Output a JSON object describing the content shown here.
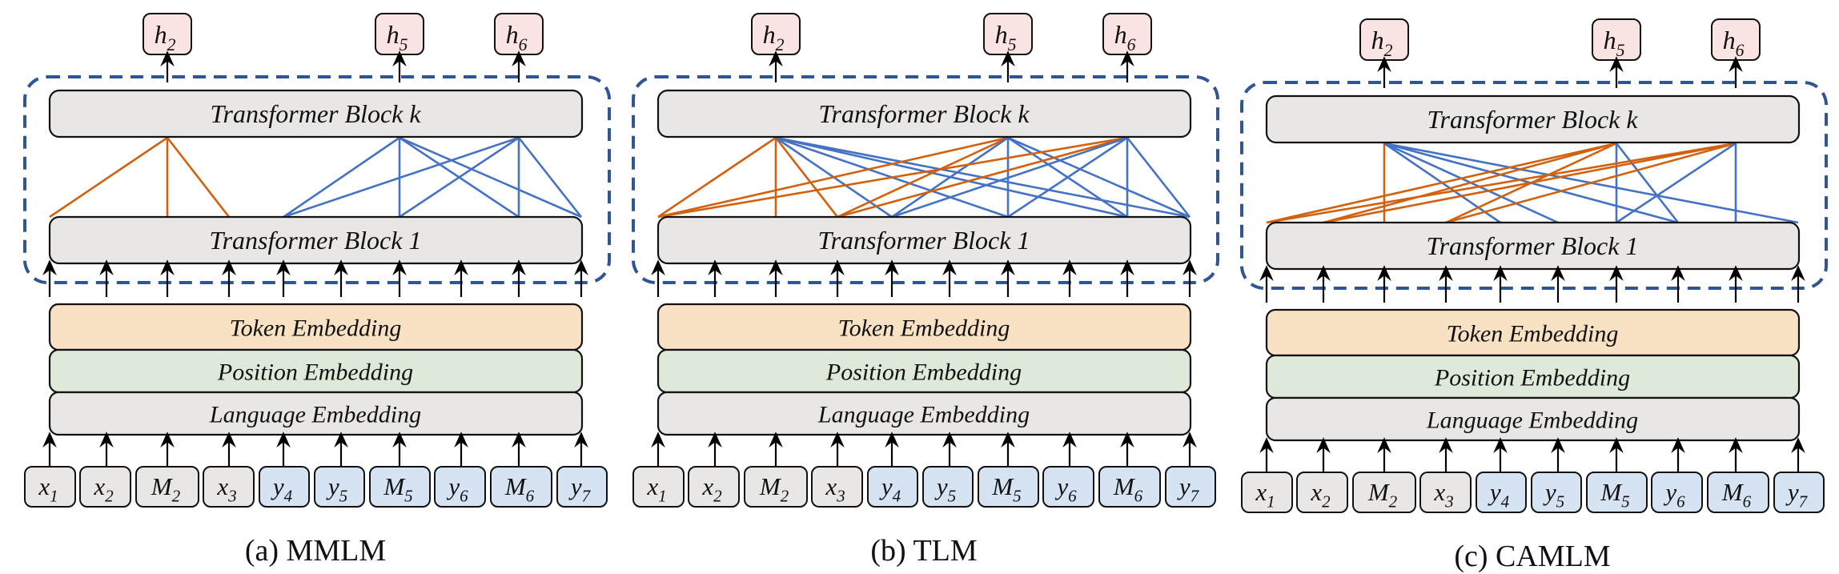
{
  "colors": {
    "block_fill": "#e8e7e5",
    "token_embedding_fill": "#f8e2c3",
    "position_embedding_fill": "#dfe9d9",
    "language_embedding_fill": "#e8e7e5",
    "source_token_fill": "#e8e7e5",
    "target_token_fill": "#d5e3f3",
    "output_fill": "#fae3e3",
    "dashed_box": "#2f5597",
    "source_edge": "#d3600d",
    "target_edge": "#4472c4"
  },
  "labels": {
    "block_k": "Transformer Block k",
    "block_1": "Transformer Block 1",
    "token_embedding": "Token Embedding",
    "position_embedding": "Position Embedding",
    "language_embedding": "Language Embedding"
  },
  "tokens": [
    {
      "base": "x",
      "sub": "1",
      "lang": "source"
    },
    {
      "base": "x",
      "sub": "2",
      "lang": "source"
    },
    {
      "base": "M",
      "sub": "2",
      "lang": "source"
    },
    {
      "base": "x",
      "sub": "3",
      "lang": "source"
    },
    {
      "base": "y",
      "sub": "4",
      "lang": "target"
    },
    {
      "base": "y",
      "sub": "5",
      "lang": "target"
    },
    {
      "base": "M",
      "sub": "5",
      "lang": "target"
    },
    {
      "base": "y",
      "sub": "6",
      "lang": "target"
    },
    {
      "base": "M",
      "sub": "6",
      "lang": "target"
    },
    {
      "base": "y",
      "sub": "7",
      "lang": "target"
    }
  ],
  "outputs": [
    {
      "base": "h",
      "sub": "2",
      "column": 2
    },
    {
      "base": "h",
      "sub": "5",
      "column": 6
    },
    {
      "base": "h",
      "sub": "6",
      "column": 8
    }
  ],
  "panels": [
    {
      "caption": "(a)  MMLM",
      "edges": [
        {
          "from": 2,
          "to": [
            0,
            2,
            3
          ],
          "color": "source"
        },
        {
          "from": 6,
          "to": [
            4,
            6,
            8,
            9
          ],
          "color": "target"
        },
        {
          "from": 8,
          "to": [
            4,
            6,
            8,
            9
          ],
          "color": "target"
        }
      ]
    },
    {
      "caption": "(b)  TLM",
      "edges": [
        {
          "from": 2,
          "to": [
            0,
            2,
            3
          ],
          "color": "source"
        },
        {
          "from": 2,
          "to": [
            4,
            6,
            8,
            9
          ],
          "color": "target"
        },
        {
          "from": 6,
          "to": [
            0,
            3
          ],
          "color": "source"
        },
        {
          "from": 6,
          "to": [
            4,
            6,
            8,
            9
          ],
          "color": "target"
        },
        {
          "from": 8,
          "to": [
            0,
            3
          ],
          "color": "source"
        },
        {
          "from": 8,
          "to": [
            4,
            6,
            8,
            9
          ],
          "color": "target"
        }
      ]
    },
    {
      "caption": "(c)  CAMLM",
      "edges": [
        {
          "from": 2,
          "to": [
            2
          ],
          "color": "source"
        },
        {
          "from": 2,
          "to": [
            4,
            5,
            7,
            9
          ],
          "color": "target"
        },
        {
          "from": 6,
          "to": [
            0,
            1,
            3
          ],
          "color": "source"
        },
        {
          "from": 6,
          "to": [
            6,
            7
          ],
          "color": "target"
        },
        {
          "from": 8,
          "to": [
            0,
            1,
            3
          ],
          "color": "source"
        },
        {
          "from": 8,
          "to": [
            6,
            8
          ],
          "color": "target"
        }
      ]
    }
  ]
}
